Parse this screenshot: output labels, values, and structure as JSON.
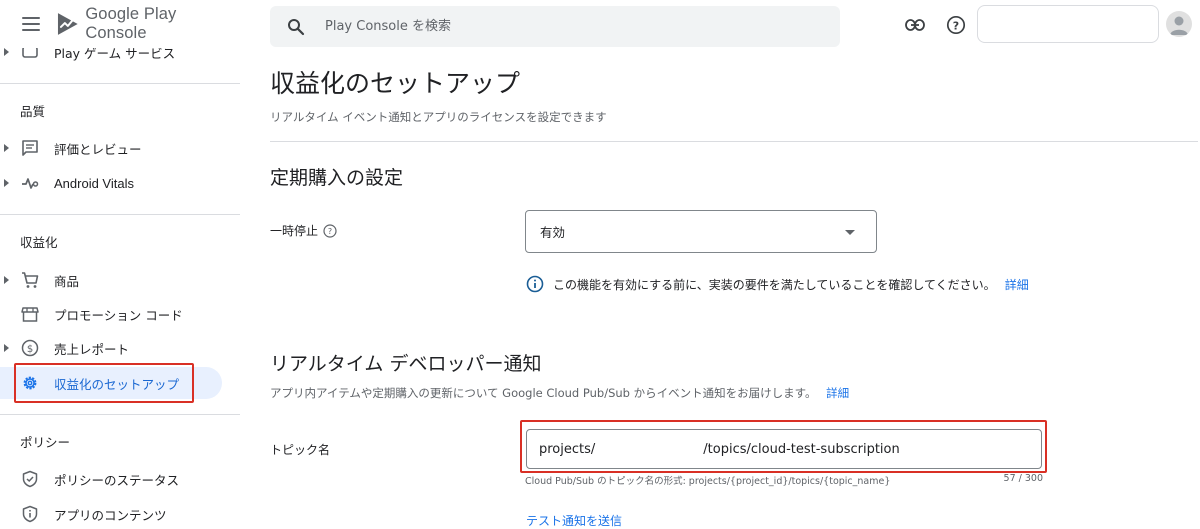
{
  "app": {
    "brand": "Google Play Console"
  },
  "search": {
    "placeholder": "Play Console を検索"
  },
  "sidebar": {
    "cutoff_item": "Play ゲーム サービス",
    "sections": [
      {
        "label": "品質",
        "items": [
          {
            "label": "評価とレビュー",
            "icon": "review-icon",
            "expandable": true
          },
          {
            "label": "Android Vitals",
            "icon": "vitals-icon",
            "expandable": true
          }
        ]
      },
      {
        "label": "収益化",
        "items": [
          {
            "label": "商品",
            "icon": "cart-icon",
            "expandable": true
          },
          {
            "label": "プロモーション コード",
            "icon": "store-icon",
            "expandable": false
          },
          {
            "label": "売上レポート",
            "icon": "dollar-icon",
            "expandable": true
          },
          {
            "label": "収益化のセットアップ",
            "icon": "gear-icon",
            "expandable": false,
            "active": true
          }
        ]
      },
      {
        "label": "ポリシー",
        "items": [
          {
            "label": "ポリシーのステータス",
            "icon": "shield-icon",
            "expandable": false
          },
          {
            "label": "アプリのコンテンツ",
            "icon": "info-icon",
            "expandable": false
          }
        ]
      }
    ]
  },
  "main": {
    "title": "収益化のセットアップ",
    "subtitle": "リアルタイム イベント通知とアプリのライセンスを設定できます",
    "subscription_section": {
      "heading": "定期購入の設定",
      "pause_label": "一時停止",
      "pause_value": "有効",
      "info_text": "この機能を有効にする前に、実装の要件を満たしていることを確認してください。",
      "info_link": "詳細"
    },
    "rtdn_section": {
      "heading": "リアルタイム デベロッパー通知",
      "description": "アプリ内アイテムや定期購入の更新について Google Cloud Pub/Sub からイベント通知をお届けします。",
      "description_link": "詳細",
      "topic_label": "トピック名",
      "topic_prefix": "projects/",
      "topic_suffix": "/topics/cloud-test-subscription",
      "topic_helper": "Cloud Pub/Sub のトピック名の形式: projects/{project_id}/topics/{topic_name}",
      "topic_counter": "57 / 300",
      "test_link": "テスト通知を送信"
    }
  },
  "colors": {
    "accent": "#1a73e8",
    "highlight": "#d93025",
    "active_bg": "#e8f0fe"
  }
}
